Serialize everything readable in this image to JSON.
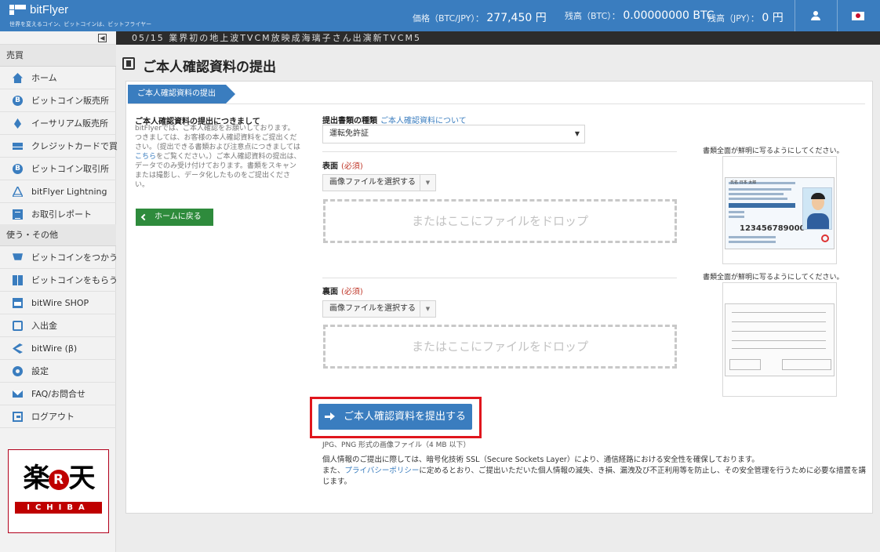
{
  "header": {
    "brand": "bitFlyer",
    "tagline": "世界を変えるコイン、ビットコインは、ビットフライヤー",
    "price_label": "価格（BTC/JPY）：",
    "price_value": "277,450 円",
    "btc_balance_label": "残高（BTC）：",
    "btc_balance_value": "0.00000000 BTC",
    "jpy_balance_label": "残高（JPY）：",
    "jpy_balance_value": "0 円",
    "account_icon": "user-icon",
    "language_icon": "flag-japan-icon"
  },
  "ticker": {
    "text": "05/15 業界初の地上波TVCM放映成海璃子さん出演新TVCM5"
  },
  "sidebar": {
    "section_trade": "売買",
    "trade_items": [
      {
        "label": "ホーム",
        "icon": "home-icon"
      },
      {
        "label": "ビットコイン販売所",
        "icon": "bitcoin-icon"
      },
      {
        "label": "イーサリアム販売所",
        "icon": "ethereum-icon"
      },
      {
        "label": "クレジットカードで買",
        "icon": "credit-card-icon"
      },
      {
        "label": "ビットコイン取引所",
        "icon": "bitcoin-icon"
      },
      {
        "label": "bitFlyer Lightning",
        "icon": "lightning-icon"
      },
      {
        "label": "お取引レポート",
        "icon": "report-icon"
      }
    ],
    "section_use": "使う・その他",
    "use_items": [
      {
        "label": "ビットコインをつかう",
        "icon": "cart-icon"
      },
      {
        "label": "ビットコインをもらう",
        "icon": "gift-icon"
      },
      {
        "label": "bitWire SHOP",
        "icon": "shop-icon"
      },
      {
        "label": "入出金",
        "icon": "cash-icon"
      },
      {
        "label": "bitWire (β)",
        "icon": "share-icon"
      },
      {
        "label": "設定",
        "icon": "gear-icon"
      },
      {
        "label": "FAQ/お問合せ",
        "icon": "mail-icon"
      },
      {
        "label": "ログアウト",
        "icon": "logout-icon"
      }
    ],
    "banner": {
      "top_left": "楽",
      "top_r": "R",
      "top_right": "天",
      "bottom": "ICHIBA"
    }
  },
  "page": {
    "title": "ご本人確認資料の提出",
    "tab": "ご本人確認資料の提出",
    "info_title": "ご本人確認資料の提出につきまして",
    "info_text_before": "bitFlyerでは、ご本人確認をお願いしております。つきましては、お客様の本人確認資料をご提出ください。（提出できる書類および注意点につきましては",
    "info_link": "こちら",
    "info_text_after": "をご覧ください。）ご本人確認資料の提出は、データでのみ受け付けております。書類をスキャンまたは撮影し、データ化したものをご提出ください。",
    "home_button": "ホームに戻る",
    "doc_type_label": "提出書類の種類",
    "doc_type_link": "ご本人確認資料について",
    "doc_type_value": "運転免許証",
    "front_label": "表面",
    "back_label": "裏面",
    "required": "(必須)",
    "file_button": "画像ファイルを選択する",
    "drop_text": "またはここにファイルをドロップ",
    "sample_note": "書類全面が鮮明に写るようにしてください。",
    "sample_front": {
      "name_label": "氏名",
      "name_value": "日本 太郎",
      "number": "123456789000"
    },
    "submit_button": "ご本人確認資料を提出する",
    "format_note": "JPG、PNG 形式の画像ファイル（4 MB 以下）",
    "privacy_line1": "個人情報のご提出に際しては、暗号化技術 SSL（Secure Sockets Layer）により、通信経路における安全性を確保しております。",
    "privacy_line2_before": "また、",
    "privacy_link": "プライバシーポリシー",
    "privacy_line2_after": "に定めるとおり、ご提出いただいた個人情報の滅失、き損、漏洩及び不正利用等を防止し、その安全管理を行うために必要な措置を講じます。"
  }
}
